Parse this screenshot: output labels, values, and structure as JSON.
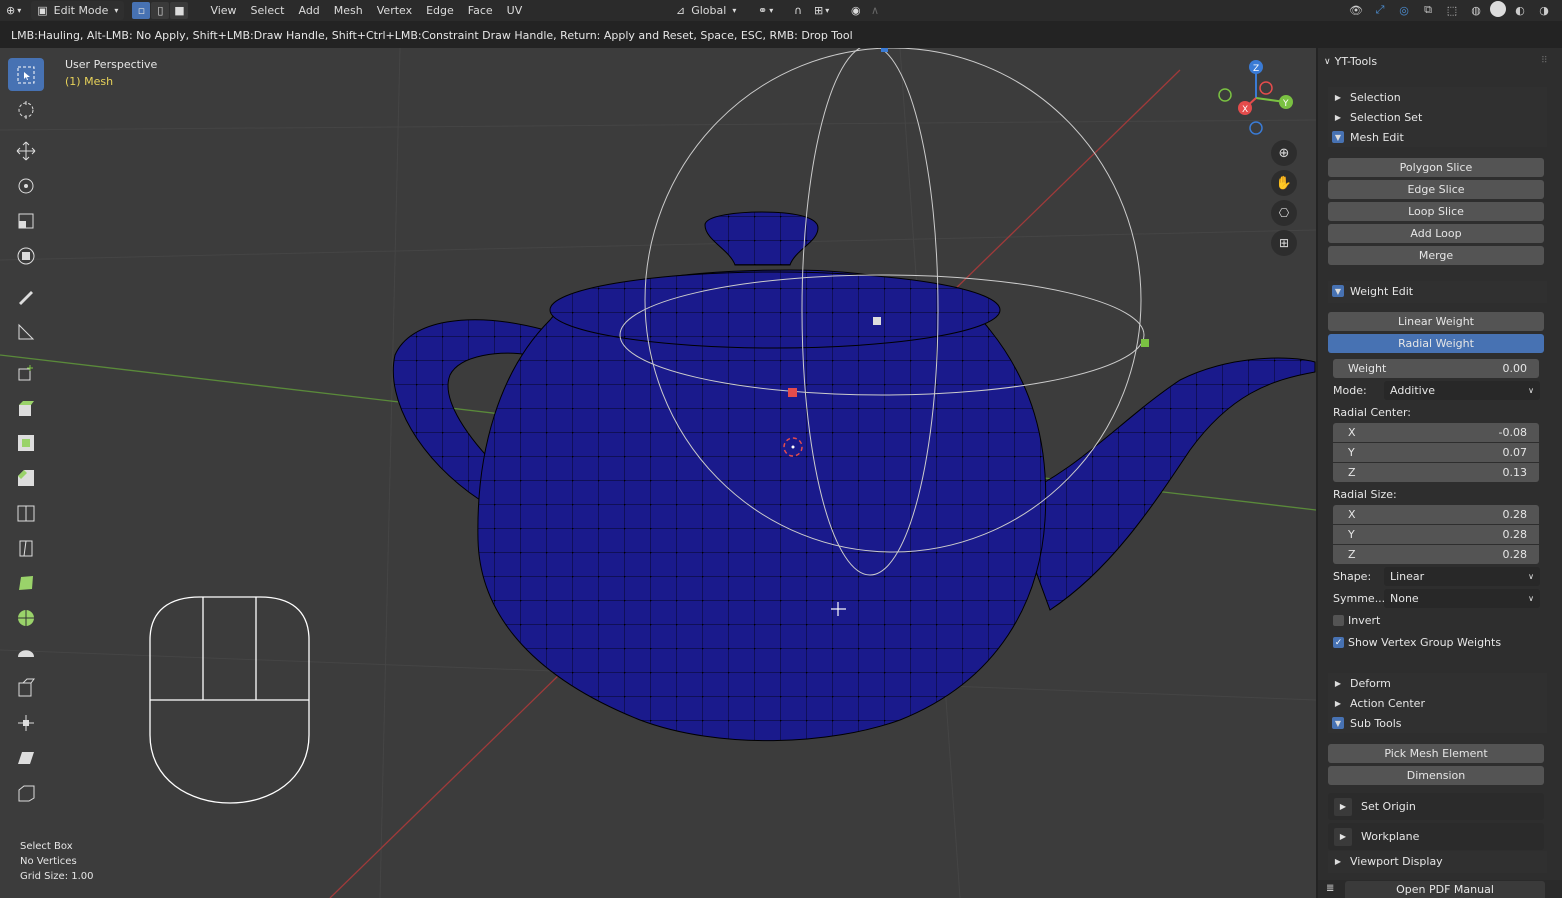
{
  "header": {
    "mode": "Edit Mode",
    "menus": [
      "View",
      "Select",
      "Add",
      "Mesh",
      "Vertex",
      "Edge",
      "Face",
      "UV"
    ],
    "orientation": "Global"
  },
  "hint": "LMB:Hauling, Alt-LMB: No Apply, Shift+LMB:Draw Handle, Shift+Ctrl+LMB:Constraint Draw Handle, Return: Apply and Reset, Space, ESC, RMB: Drop Tool",
  "viewport": {
    "title": "User Perspective",
    "subtitle": "(1) Mesh",
    "gizmo": {
      "z": "Z",
      "y": "Y",
      "x": "X"
    }
  },
  "info": {
    "line1": "Select Box",
    "line2": "No Vertices",
    "line3": "Grid Size: 1.00"
  },
  "panel": {
    "title": "YT-Tools",
    "sections_top": [
      "Selection",
      "Selection Set",
      "Mesh Edit"
    ],
    "mesh_edit_buttons": [
      "Polygon Slice",
      "Edge Slice",
      "Loop Slice",
      "Add Loop",
      "Merge"
    ],
    "weight_edit": "Weight Edit",
    "linear_weight": "Linear Weight",
    "radial_weight": "Radial Weight",
    "weight_label": "Weight",
    "weight_value": "0.00",
    "mode_label": "Mode:",
    "mode_value": "Additive",
    "radial_center_label": "Radial Center:",
    "radial_center": [
      {
        "axis": "X",
        "value": "-0.08"
      },
      {
        "axis": "Y",
        "value": "0.07"
      },
      {
        "axis": "Z",
        "value": "0.13"
      }
    ],
    "radial_size_label": "Radial Size:",
    "radial_size": [
      {
        "axis": "X",
        "value": "0.28"
      },
      {
        "axis": "Y",
        "value": "0.28"
      },
      {
        "axis": "Z",
        "value": "0.28"
      }
    ],
    "shape_label": "Shape:",
    "shape_value": "Linear",
    "symmetry_label": "Symme...",
    "symmetry_value": "None",
    "invert": "Invert",
    "show_weights": "Show Vertex Group Weights",
    "sections_bottom": [
      "Deform",
      "Action Center",
      "Sub Tools"
    ],
    "sub_buttons": [
      "Pick Mesh Element",
      "Dimension"
    ],
    "set_origin": "Set Origin",
    "workplane": "Workplane",
    "viewport_display": "Viewport Display",
    "pdf_manual": "Open PDF Manual"
  },
  "colors": {
    "accent": "#4772b3",
    "mesh": "#1a1a8c",
    "panel": "#2e2e2e",
    "viewport": "#3c3c3c"
  }
}
